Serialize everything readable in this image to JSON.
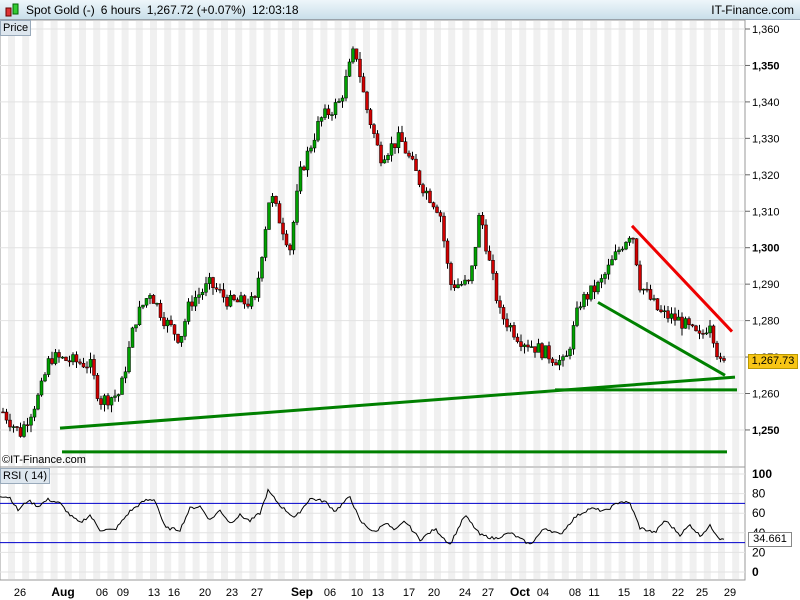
{
  "header": {
    "instrument": "Spot Gold (-)",
    "timeframe": "6 hours",
    "price": "1,267.72 (+0.07%)",
    "time": "12:03:18",
    "brand": "IT-Finance.com"
  },
  "price_panel": {
    "label": "Price",
    "copyright": "©IT-Finance.com",
    "current_price": "1,267.73",
    "y_ticks": [
      "1,360",
      "1,350",
      "1,340",
      "1,330",
      "1,320",
      "1,310",
      "1,300",
      "1,290",
      "1,280",
      "1,270",
      "1,260",
      "1,250"
    ],
    "y_tick_values": [
      1360,
      1350,
      1340,
      1330,
      1320,
      1310,
      1300,
      1290,
      1280,
      1270,
      1260,
      1250
    ],
    "path": [
      [
        0,
        1256
      ],
      [
        20,
        1249
      ],
      [
        40,
        1260
      ],
      [
        50,
        1270
      ],
      [
        90,
        1268
      ],
      [
        100,
        1258
      ],
      [
        120,
        1260
      ],
      [
        135,
        1280
      ],
      [
        150,
        1288
      ],
      [
        165,
        1280
      ],
      [
        180,
        1275
      ],
      [
        190,
        1285
      ],
      [
        210,
        1290
      ],
      [
        230,
        1285
      ],
      [
        255,
        1285
      ],
      [
        270,
        1315
      ],
      [
        290,
        1300
      ],
      [
        300,
        1320
      ],
      [
        320,
        1335
      ],
      [
        340,
        1340
      ],
      [
        355,
        1355
      ],
      [
        365,
        1340
      ],
      [
        380,
        1325
      ],
      [
        400,
        1330
      ],
      [
        420,
        1318
      ],
      [
        440,
        1310
      ],
      [
        450,
        1290
      ],
      [
        470,
        1290
      ],
      [
        480,
        1310
      ],
      [
        490,
        1295
      ],
      [
        500,
        1282
      ],
      [
        520,
        1275
      ],
      [
        540,
        1272
      ],
      [
        565,
        1268
      ],
      [
        580,
        1285
      ],
      [
        600,
        1290
      ],
      [
        620,
        1300
      ],
      [
        632,
        1305
      ],
      [
        640,
        1290
      ],
      [
        660,
        1282
      ],
      [
        680,
        1280
      ],
      [
        700,
        1275
      ],
      [
        710,
        1280
      ],
      [
        720,
        1268
      ],
      [
        725,
        1268
      ]
    ],
    "trendlines": [
      {
        "color": "#008000",
        "from": [
          60,
          1250.5
        ],
        "to": [
          735,
          1264.5
        ]
      },
      {
        "color": "#008000",
        "from": [
          555,
          1261
        ],
        "to": [
          737,
          1261
        ]
      },
      {
        "color": "#008000",
        "from": [
          62,
          1244
        ],
        "to": [
          727,
          1244
        ]
      },
      {
        "color": "#008000",
        "from": [
          598,
          1285
        ],
        "to": [
          725,
          1265
        ]
      },
      {
        "color": "#ee0000",
        "from": [
          632,
          1306
        ],
        "to": [
          732,
          1277
        ]
      }
    ]
  },
  "rsi_panel": {
    "label": "RSI ( 14)",
    "current": "34.661",
    "y_ticks": [
      "100",
      "80",
      "60",
      "40",
      "20",
      "0"
    ],
    "y_tick_values": [
      100,
      80,
      60,
      40,
      20,
      0
    ],
    "levels": [
      70,
      30
    ],
    "path": [
      [
        0,
        78
      ],
      [
        10,
        76
      ],
      [
        18,
        63
      ],
      [
        28,
        73
      ],
      [
        38,
        67
      ],
      [
        48,
        74
      ],
      [
        60,
        70
      ],
      [
        70,
        58
      ],
      [
        80,
        50
      ],
      [
        90,
        58
      ],
      [
        100,
        43
      ],
      [
        115,
        43
      ],
      [
        130,
        62
      ],
      [
        145,
        73
      ],
      [
        155,
        74
      ],
      [
        165,
        45
      ],
      [
        180,
        43
      ],
      [
        190,
        65
      ],
      [
        200,
        67
      ],
      [
        210,
        53
      ],
      [
        220,
        63
      ],
      [
        230,
        50
      ],
      [
        240,
        58
      ],
      [
        250,
        52
      ],
      [
        260,
        60
      ],
      [
        268,
        83
      ],
      [
        280,
        68
      ],
      [
        295,
        55
      ],
      [
        310,
        75
      ],
      [
        325,
        72
      ],
      [
        335,
        62
      ],
      [
        350,
        77
      ],
      [
        360,
        52
      ],
      [
        375,
        40
      ],
      [
        385,
        51
      ],
      [
        395,
        42
      ],
      [
        405,
        52
      ],
      [
        420,
        33
      ],
      [
        435,
        44
      ],
      [
        450,
        28
      ],
      [
        465,
        58
      ],
      [
        480,
        38
      ],
      [
        495,
        34
      ],
      [
        510,
        40
      ],
      [
        530,
        28
      ],
      [
        545,
        45
      ],
      [
        560,
        38
      ],
      [
        575,
        56
      ],
      [
        590,
        65
      ],
      [
        605,
        62
      ],
      [
        620,
        72
      ],
      [
        630,
        70
      ],
      [
        640,
        45
      ],
      [
        655,
        40
      ],
      [
        665,
        53
      ],
      [
        680,
        38
      ],
      [
        690,
        48
      ],
      [
        700,
        37
      ],
      [
        710,
        47
      ],
      [
        720,
        34
      ],
      [
        725,
        35
      ]
    ]
  },
  "x_axis": {
    "labels": [
      [
        "26",
        20
      ],
      [
        "Aug",
        63
      ],
      [
        "06",
        102
      ],
      [
        "09",
        123
      ],
      [
        "13",
        154
      ],
      [
        "16",
        174
      ],
      [
        "20",
        205
      ],
      [
        "23",
        232
      ],
      [
        "27",
        257
      ],
      [
        "Sep",
        302
      ],
      [
        "06",
        330
      ],
      [
        "10",
        357
      ],
      [
        "13",
        378
      ],
      [
        "17",
        409
      ],
      [
        "20",
        434
      ],
      [
        "24",
        465
      ],
      [
        "27",
        488
      ],
      [
        "Oct",
        520
      ],
      [
        "04",
        543
      ],
      [
        "08",
        575
      ],
      [
        "11",
        594
      ],
      [
        "15",
        624
      ],
      [
        "18",
        649
      ],
      [
        "22",
        678
      ],
      [
        "25",
        702
      ],
      [
        "29",
        730
      ]
    ],
    "bold": [
      "Aug",
      "Sep",
      "Oct"
    ]
  },
  "colors": {
    "up": "#00a000",
    "down": "#d00000",
    "trend_green": "#008000",
    "trend_red": "#ee0000",
    "rsi_level": "#0000cc"
  }
}
